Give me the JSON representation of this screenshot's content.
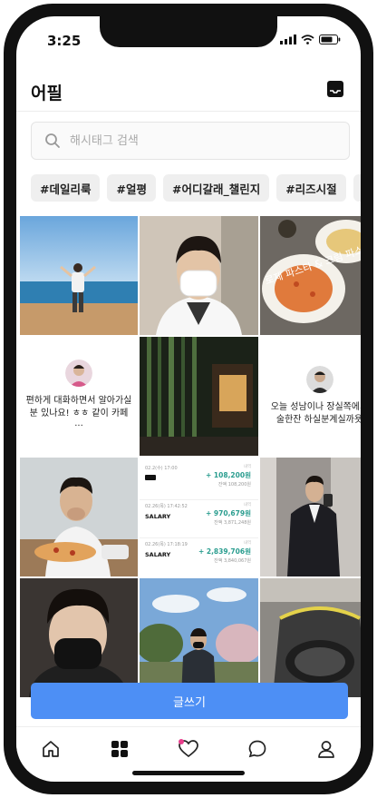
{
  "status_bar": {
    "time": "3:25"
  },
  "header": {
    "title": "어필"
  },
  "search": {
    "placeholder": "해시태그 검색"
  },
  "hashtags": [
    "#데일리룩",
    "#얼평",
    "#어디갈래_챌린지",
    "#리즈시절",
    "#"
  ],
  "posts": [
    {
      "message": "편하게 대화하면서 알아가실 분 있나요! ㅎㅎ 같이 카페···"
    },
    {
      "message": "오늘 성남이나 장실쪽에서 술한잔 하실분계실까욧"
    }
  ],
  "image_overlays": {
    "pasta_caption": "로제 파스타 & 크림 파스타"
  },
  "bank_rows": [
    {
      "date": "02.2(수) 17:00",
      "tag": "내역",
      "name": "",
      "amount": "+ 108,200원",
      "balance": "잔액 108,200원"
    },
    {
      "date": "02.26(목) 17:42:52",
      "tag": "내역",
      "name": "SALARY",
      "amount": "+ 970,679원",
      "balance": "잔액 3,871,248원"
    },
    {
      "date": "02.26(목) 17:18:19",
      "tag": "내역",
      "name": "SALARY",
      "amount": "+ 2,839,706원",
      "balance": "잔액 3,840,067원"
    }
  ],
  "cta": {
    "label": "글쓰기"
  },
  "colors": {
    "accent": "#4d8ff5",
    "notification_dot": "#e83e8c"
  }
}
